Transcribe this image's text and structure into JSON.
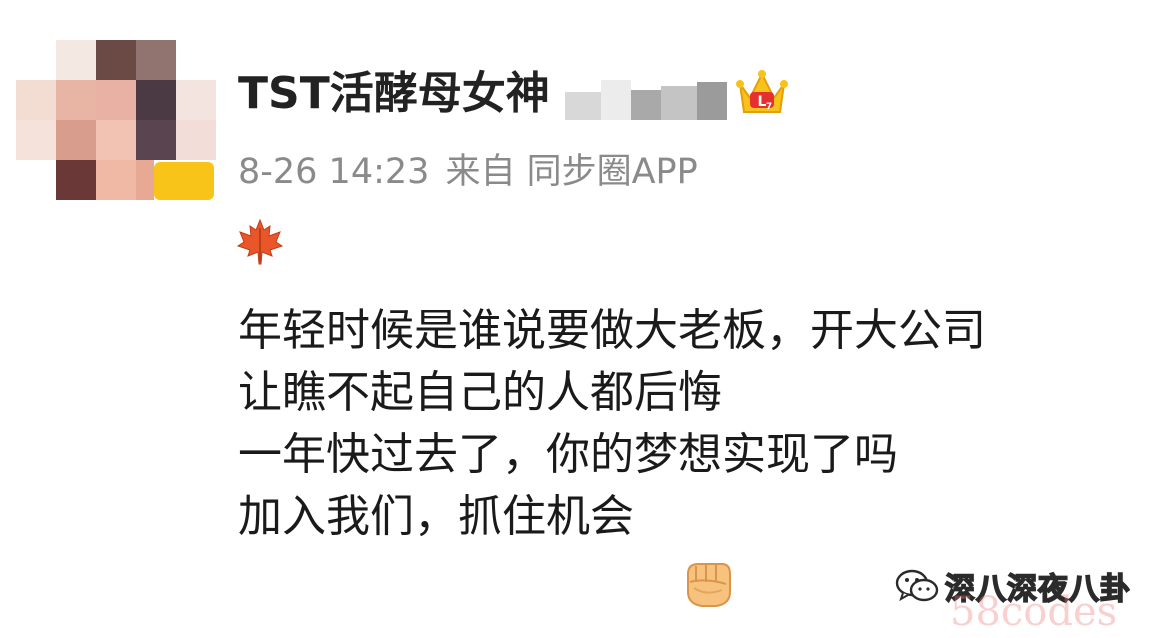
{
  "post": {
    "username": "TST活酵母女神",
    "timestamp": "8-26 14:23",
    "source": "来自 同步圈APP",
    "lines": [
      "年轻时候是谁说要做大老板，开大公司",
      "让瞧不起自己的人都后悔",
      "一年快过去了，你的梦想实现了吗",
      "加入我们，抓住机会"
    ]
  },
  "icons": {
    "leaf": "maple-leaf-icon",
    "crown": "crown-badge-icon",
    "fist": "fist-icon",
    "wechat": "wechat-channel-icon"
  },
  "watermark": {
    "channel": "深八深夜八卦",
    "site": "58codes"
  },
  "colors": {
    "name": "#222222",
    "meta": "#8a8a8a",
    "body": "#1a1a1a",
    "crown": "#f7c21b",
    "crown_gem": "#e5302f",
    "badge": "#f8c41a",
    "site_mark": "#ee7878"
  }
}
